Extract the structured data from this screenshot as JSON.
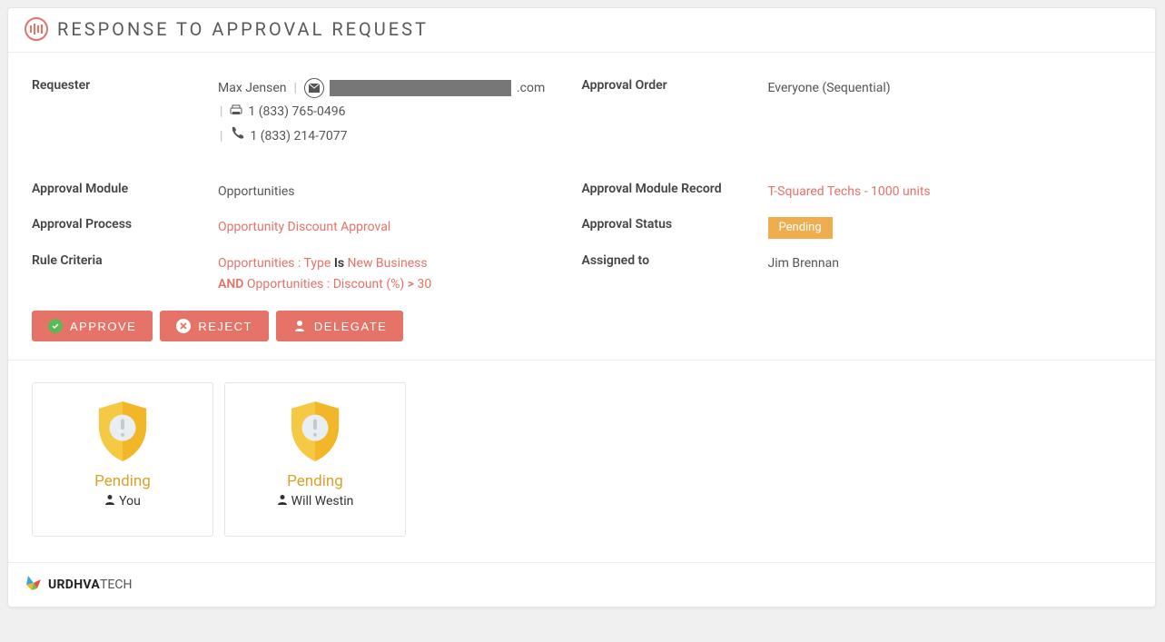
{
  "header": {
    "title": "RESPONSE TO APPROVAL REQUEST"
  },
  "details": {
    "requester": {
      "label": "Requester",
      "name": "Max Jensen",
      "email_suffix": ".com",
      "fax": "1 (833) 765-0496",
      "phone": "1 (833) 214-7077"
    },
    "approval_order": {
      "label": "Approval Order",
      "value": "Everyone (Sequential)"
    },
    "approval_module": {
      "label": "Approval Module",
      "value": "Opportunities"
    },
    "approval_module_record": {
      "label": "Approval Module Record",
      "value": "T-Squared Techs - 1000 units"
    },
    "approval_process": {
      "label": "Approval Process",
      "value": "Opportunity Discount Approval"
    },
    "approval_status": {
      "label": "Approval Status",
      "value": "Pending"
    },
    "rule_criteria": {
      "label": "Rule Criteria",
      "line1_field": "Opportunities : Type",
      "line1_op": "Is",
      "line1_val": "New Business",
      "connector": "AND",
      "line2_field": "Opportunities : Discount (%)",
      "line2_op": ">",
      "line2_val": "30"
    },
    "assigned_to": {
      "label": "Assigned to",
      "value": "Jim Brennan"
    }
  },
  "actions": {
    "approve": "APPROVE",
    "reject": "REJECT",
    "delegate": "DELEGATE"
  },
  "approvers": [
    {
      "status": "Pending",
      "name": "You"
    },
    {
      "status": "Pending",
      "name": "Will Westin"
    }
  ],
  "footer": {
    "brand_strong": "URDHVA",
    "brand_light": "TECH"
  }
}
